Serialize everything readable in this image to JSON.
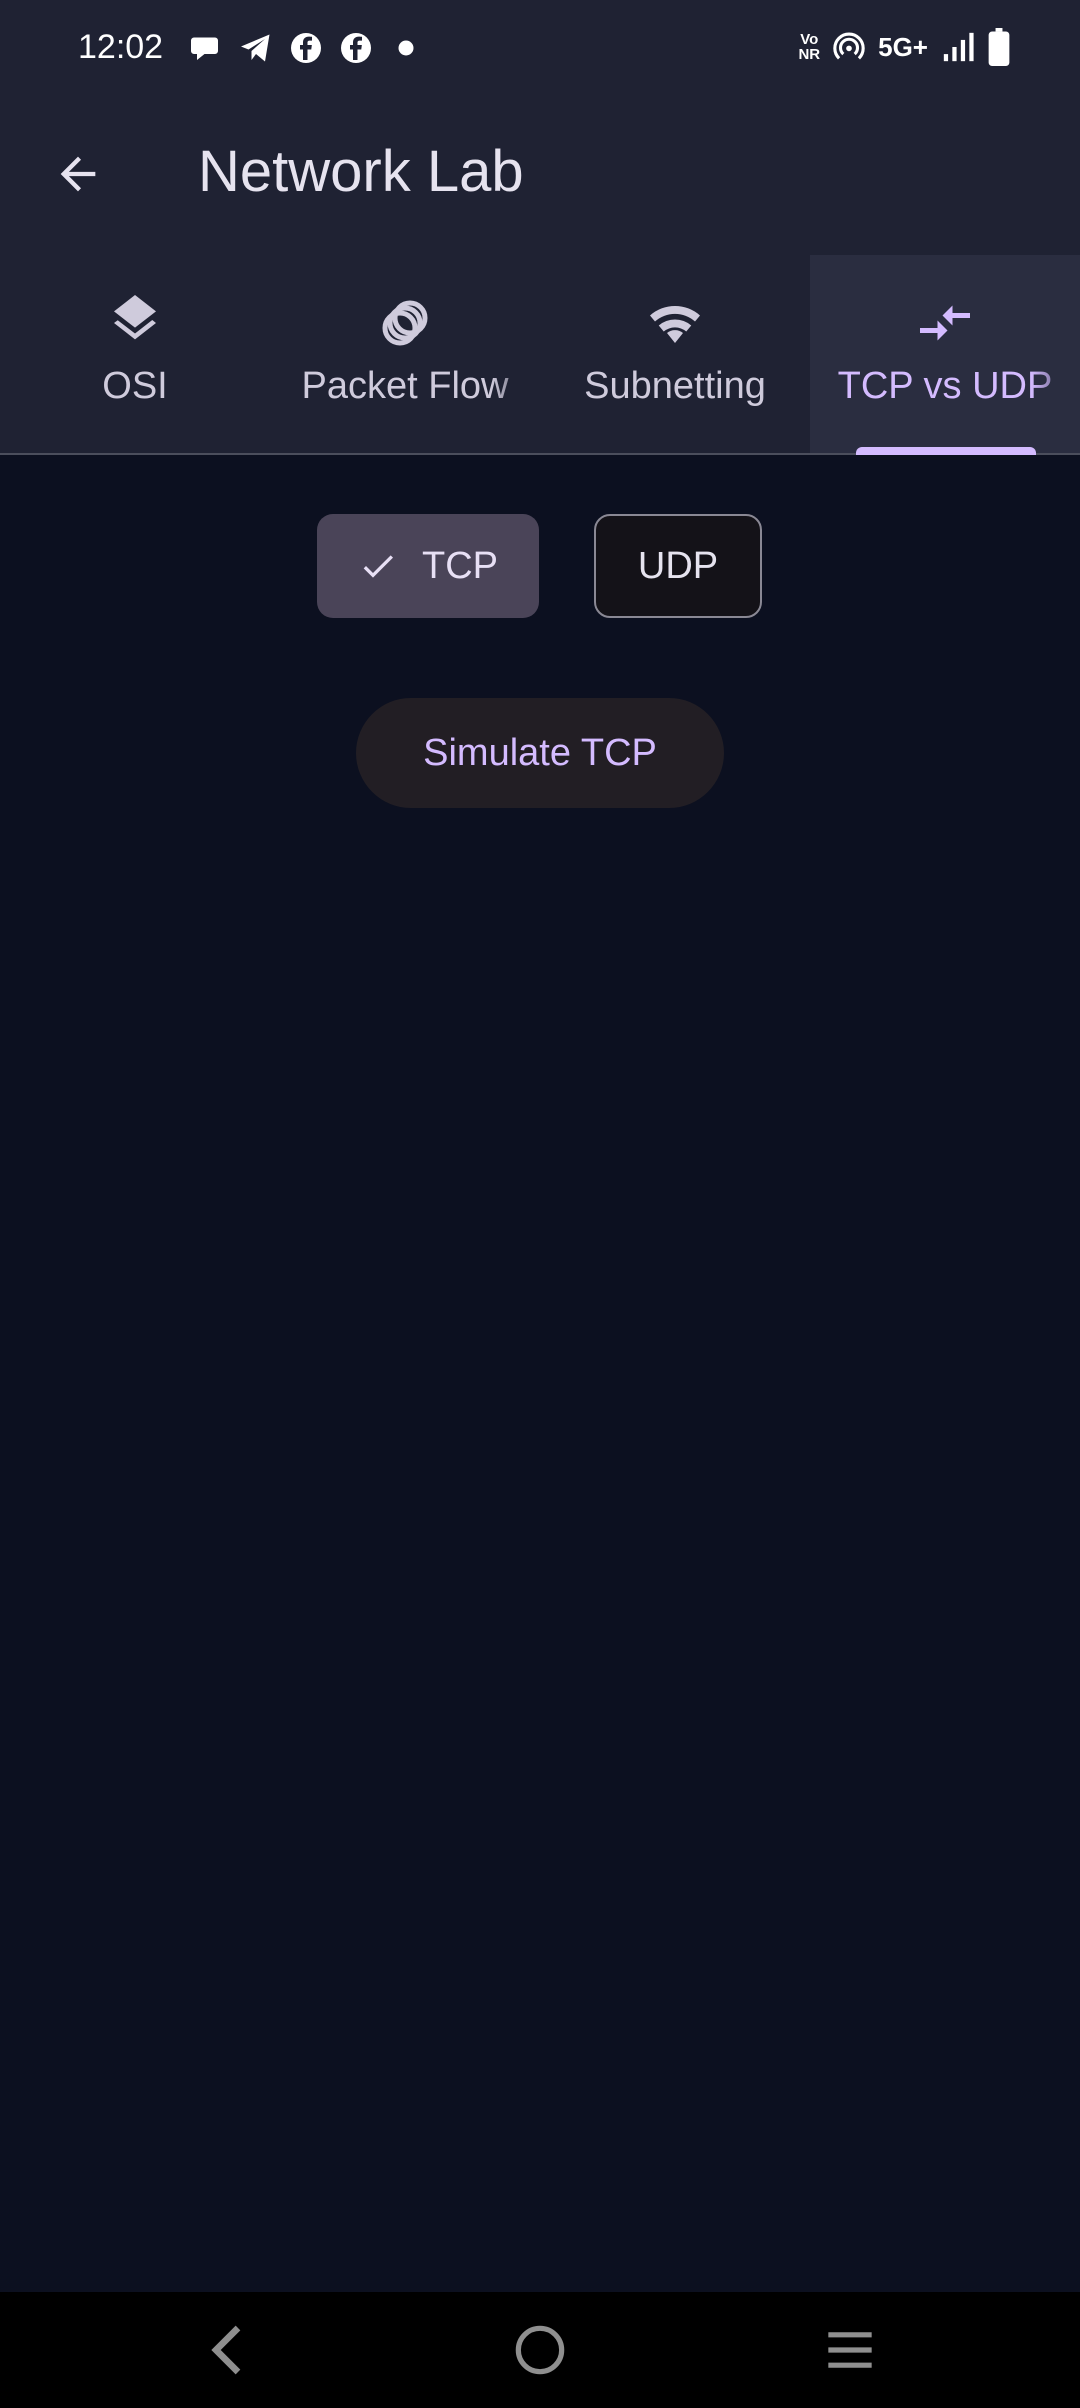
{
  "status_bar": {
    "time": "12:02",
    "notification_icons": [
      "chat-bubble-icon",
      "telegram-icon",
      "facebook-icon",
      "facebook-icon",
      "dot-icon"
    ],
    "vonr_label": "Vo\nNR",
    "network_label": "5G+",
    "right_icons": [
      "vonr-icon",
      "hotspot-icon",
      "5g-icon",
      "signal-icon",
      "battery-icon"
    ]
  },
  "app_bar": {
    "title": "Network Lab",
    "back_icon": "arrow-back-icon"
  },
  "tabs": [
    {
      "label": "OSI",
      "icon": "layers-icon",
      "selected": false
    },
    {
      "label": "Packet Flow",
      "icon": "rings-icon",
      "selected": false
    },
    {
      "label": "Subnetting",
      "icon": "wifi-icon",
      "selected": false
    },
    {
      "label": "TCP vs UDP",
      "icon": "compare-arrows-icon",
      "selected": true
    }
  ],
  "protocol_selector": {
    "tcp_label": "TCP",
    "udp_label": "UDP",
    "selected": "TCP",
    "check_icon": "check-icon"
  },
  "simulate_button": {
    "label": "Simulate TCP"
  },
  "nav_bar": {
    "icons": [
      "nav-back-icon",
      "nav-home-icon",
      "nav-menu-icon"
    ]
  },
  "colors": {
    "background": "#0c1020",
    "app_bar": "#1f2233",
    "accent": "#d4bbff",
    "selected_segment": "#4a4458"
  }
}
